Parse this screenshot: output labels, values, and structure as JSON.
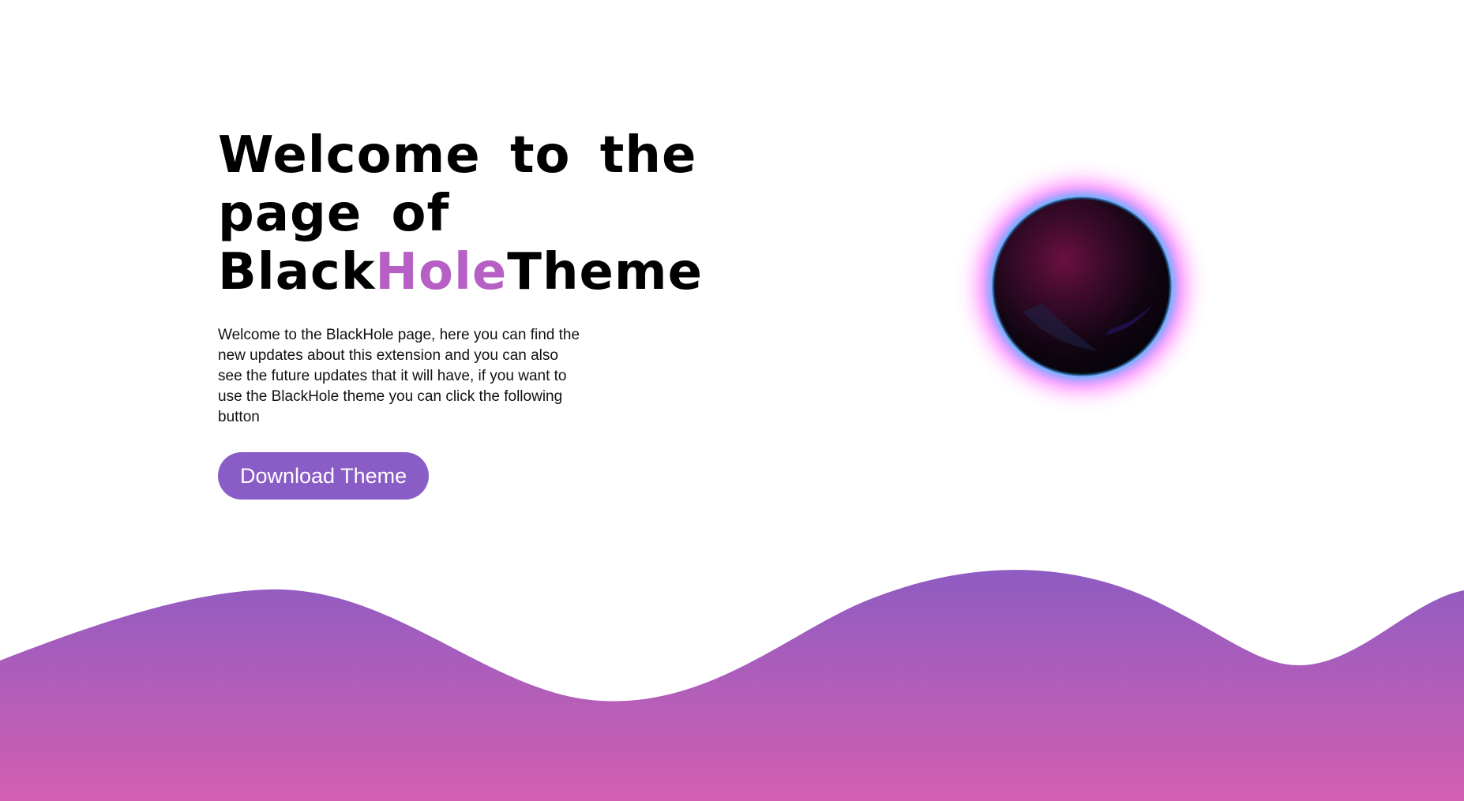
{
  "hero": {
    "title_line1": "Welcome to the page of",
    "title_part_black": "Black",
    "title_part_accent": "Hole",
    "title_part_end": "Theme",
    "description": "Welcome to the BlackHole page, here you can find the new updates about this extension and you can also see the future updates that it will have, if you want to use the BlackHole theme you can click the following button",
    "download_label": "Download Theme"
  },
  "illustration": {
    "icon": "black-hole-icon"
  },
  "colors": {
    "accent": "#b65fc4",
    "button": "#8a5cc6",
    "wave_top": "#8e5cc2",
    "wave_bottom": "#d35fb1",
    "glow_outer": "#ff40ff",
    "glow_inner": "#40d0ff"
  }
}
